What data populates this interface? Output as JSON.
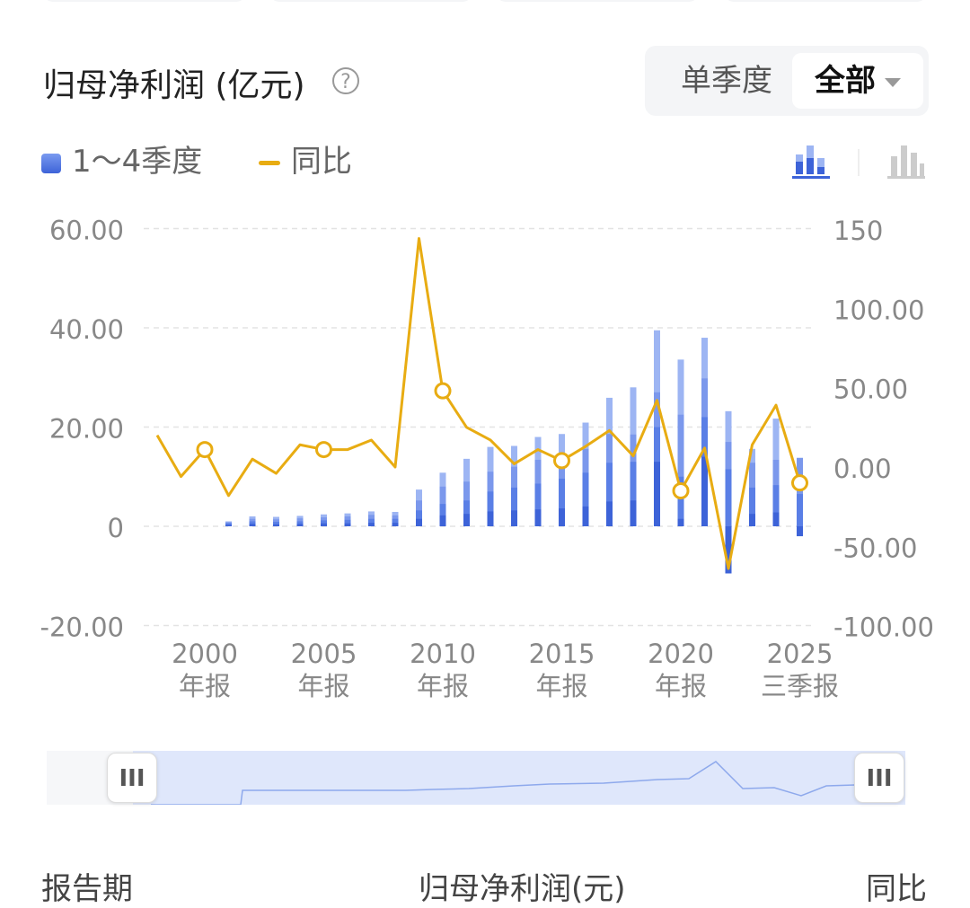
{
  "header": {
    "title": "归母净利润 (亿元)",
    "help_icon": "question-circle-icon"
  },
  "period_toggle": {
    "options": [
      "单季度",
      "全部"
    ],
    "selected": "全部"
  },
  "legend": {
    "bars_label": "1～4季度",
    "line_label": "同比"
  },
  "view_icons": [
    "stacked-bar-icon",
    "bar-icon"
  ],
  "colors": {
    "bar_dark": "#3d63d8",
    "bar_mid": "#5a7fe6",
    "bar_light": "#9db5f3",
    "line": "#e8ac12",
    "grid": "#e3e3e3"
  },
  "chart_data": {
    "type": "bar",
    "left_axis": {
      "ticks": [
        60,
        40,
        20,
        0,
        -20
      ],
      "tick_labels": [
        "60.00",
        "40.00",
        "20.00",
        "0",
        "-20.00"
      ],
      "ylim": [
        -20,
        60
      ]
    },
    "right_axis": {
      "ticks": [
        150,
        100,
        50,
        0,
        -50,
        -100
      ],
      "tick_labels": [
        "150",
        "100.00",
        "50.00",
        "0.00",
        "-50.00",
        "-100.00"
      ],
      "ylim": [
        -100,
        150
      ]
    },
    "x_ticks": [
      {
        "year": 2000,
        "line1": "2000",
        "line2": "年报"
      },
      {
        "year": 2005,
        "line1": "2005",
        "line2": "年报"
      },
      {
        "year": 2010,
        "line1": "2010",
        "line2": "年报"
      },
      {
        "year": 2015,
        "line1": "2015",
        "line2": "年报"
      },
      {
        "year": 2020,
        "line1": "2020",
        "line2": "年报"
      },
      {
        "year": 2025,
        "line1": "2025",
        "line2": "三季报"
      }
    ],
    "bars": [
      {
        "year": 2001,
        "q": [
          0.3,
          0.6,
          0.8,
          1.0
        ]
      },
      {
        "year": 2002,
        "q": [
          0.5,
          1.0,
          1.5,
          2.0
        ]
      },
      {
        "year": 2003,
        "q": [
          0.4,
          0.9,
          1.4,
          1.9
        ]
      },
      {
        "year": 2004,
        "q": [
          0.5,
          1.0,
          1.6,
          2.1
        ]
      },
      {
        "year": 2005,
        "q": [
          0.6,
          1.2,
          1.8,
          2.4
        ]
      },
      {
        "year": 2006,
        "q": [
          0.6,
          1.3,
          2.0,
          2.6
        ]
      },
      {
        "year": 2007,
        "q": [
          0.7,
          1.5,
          2.3,
          3.0
        ]
      },
      {
        "year": 2008,
        "q": [
          0.7,
          1.5,
          2.2,
          2.9
        ]
      },
      {
        "year": 2009,
        "q": [
          1.5,
          3.2,
          5.2,
          7.4
        ]
      },
      {
        "year": 2010,
        "q": [
          2.2,
          4.5,
          8.0,
          10.8
        ]
      },
      {
        "year": 2011,
        "q": [
          2.5,
          5.2,
          9.0,
          13.6
        ]
      },
      {
        "year": 2012,
        "q": [
          3.0,
          7.0,
          11.0,
          16.0
        ]
      },
      {
        "year": 2013,
        "q": [
          3.2,
          7.8,
          12.0,
          16.2
        ]
      },
      {
        "year": 2014,
        "q": [
          3.4,
          8.6,
          13.4,
          18.0
        ]
      },
      {
        "year": 2015,
        "q": [
          3.6,
          9.6,
          14.2,
          18.6
        ]
      },
      {
        "year": 2016,
        "q": [
          4.0,
          10.8,
          15.6,
          20.9
        ]
      },
      {
        "year": 2017,
        "q": [
          5.0,
          12.8,
          18.6,
          25.9
        ]
      },
      {
        "year": 2018,
        "q": [
          5.2,
          13.0,
          18.5,
          28.0
        ]
      },
      {
        "year": 2019,
        "q": [
          13.0,
          20.0,
          27.0,
          39.5
        ]
      },
      {
        "year": 2020,
        "q": [
          1.5,
          10.0,
          22.5,
          33.6
        ]
      },
      {
        "year": 2021,
        "q": [
          14.0,
          22.0,
          29.8,
          38.0
        ]
      },
      {
        "year": 2022,
        "q": [
          -9.5,
          11.5,
          17.0,
          23.2
        ]
      },
      {
        "year": 2023,
        "q": [
          2.5,
          7.8,
          12.8,
          15.6
        ]
      },
      {
        "year": 2024,
        "q": [
          2.8,
          8.3,
          13.4,
          21.7
        ]
      },
      {
        "year": 2025,
        "q": [
          -2.0,
          6.5,
          13.8
        ]
      }
    ],
    "yoy_series": {
      "name": "同比",
      "x": [
        1998,
        1999,
        2000,
        2001,
        2002,
        2003,
        2004,
        2005,
        2006,
        2007,
        2008,
        2009,
        2010,
        2011,
        2012,
        2013,
        2014,
        2015,
        2016,
        2017,
        2018,
        2019,
        2020,
        2021,
        2022,
        2023,
        2024,
        2025
      ],
      "values": [
        20,
        -6,
        11,
        -18,
        5,
        -4,
        14,
        11,
        11,
        17,
        0,
        144,
        48,
        25,
        17,
        2,
        11,
        4,
        13,
        23,
        7,
        42,
        -15,
        12,
        -64,
        14,
        39,
        -10
      ],
      "markers": [
        2000,
        2005,
        2010,
        2015,
        2020,
        2025
      ]
    }
  },
  "range_slider": {
    "handle_left": "III",
    "handle_right": "III"
  },
  "table_header": {
    "col1": "报告期",
    "col2": "归母净利润(元)",
    "col3": "同比"
  }
}
